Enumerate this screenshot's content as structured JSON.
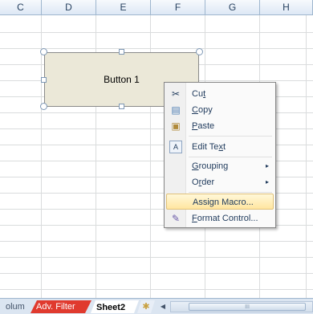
{
  "columns": [
    "C",
    "D",
    "E",
    "F",
    "G",
    "H"
  ],
  "form_button": {
    "label": "Button 1"
  },
  "context_menu": {
    "items": [
      {
        "pre": "Cu",
        "key": "t",
        "post": "",
        "icon": "✂"
      },
      {
        "pre": "",
        "key": "C",
        "post": "opy",
        "icon": "▤"
      },
      {
        "pre": "",
        "key": "P",
        "post": "aste",
        "icon": "▣"
      },
      {
        "pre": "Edit Te",
        "key": "x",
        "post": "t",
        "icon": "A"
      },
      {
        "pre": "",
        "key": "G",
        "post": "rouping",
        "icon": ""
      },
      {
        "pre": "O",
        "key": "r",
        "post": "der",
        "icon": ""
      },
      {
        "pre": "Assi",
        "key": "g",
        "post": "n Macro...",
        "icon": ""
      },
      {
        "pre": "",
        "key": "F",
        "post": "ormat Control...",
        "icon": "✎"
      }
    ],
    "submenu_arrow": "▸"
  },
  "sheet_tabs": {
    "partial": "olum",
    "adv_filter": "Adv. Filter",
    "active": "Sheet2",
    "new_sheet_icon": "✱",
    "scroll_left": "◀",
    "scroll_thumb_grip": "III"
  }
}
